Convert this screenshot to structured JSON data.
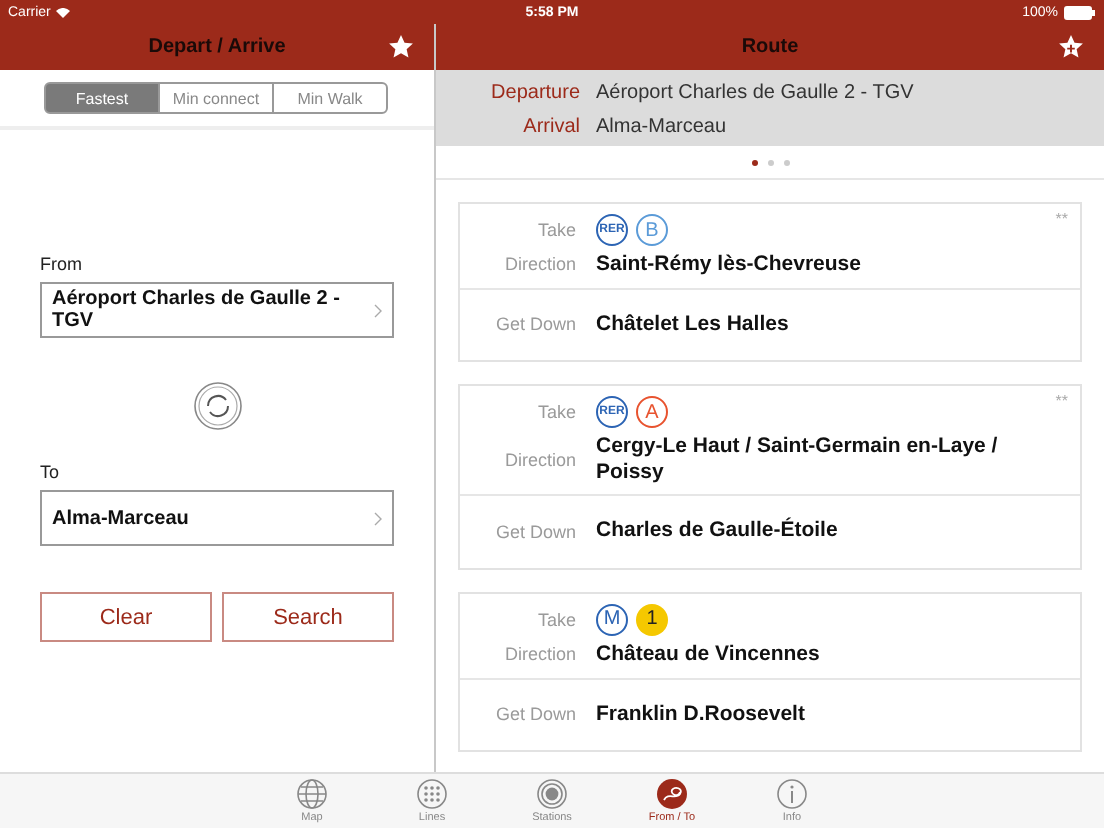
{
  "status_bar": {
    "carrier": "Carrier",
    "time": "5:58 PM",
    "battery": "100%"
  },
  "left_panel": {
    "title": "Depart / Arrive",
    "segments": [
      {
        "label": "Fastest",
        "selected": true
      },
      {
        "label": "Min connect",
        "selected": false
      },
      {
        "label": "Min Walk",
        "selected": false
      }
    ],
    "from": {
      "label": "From",
      "value": "Aéroport Charles de Gaulle 2 - TGV"
    },
    "to": {
      "label": "To",
      "value": "Alma-Marceau"
    },
    "buttons": [
      "Clear",
      "Search"
    ]
  },
  "right_panel": {
    "title": "Route",
    "summary": [
      {
        "label": "Departure",
        "value": "Aéroport Charles de Gaulle 2 - TGV"
      },
      {
        "label": "Arrival",
        "value": "Alma-Marceau"
      }
    ],
    "pages": [
      {
        "selected": true
      },
      {
        "selected": false
      },
      {
        "selected": false
      }
    ],
    "legs": [
      {
        "take_label": "Take",
        "badges": [
          {
            "label": "RER",
            "kind": "outline",
            "color": "#2c64b4"
          },
          {
            "label": "B",
            "kind": "outline",
            "color": "#5b9bd8"
          }
        ],
        "direction_label": "Direction",
        "direction": "Saint-Rémy lès-Chevreuse",
        "get_down_label": "Get Down",
        "get_down": "Châtelet Les Halles",
        "mark": "**"
      },
      {
        "take_label": "Take",
        "badges": [
          {
            "label": "RER",
            "kind": "outline",
            "color": "#2c64b4"
          },
          {
            "label": "A",
            "kind": "outline",
            "color": "#e8532f"
          }
        ],
        "direction_label": "Direction",
        "direction": "Cergy-Le Haut / Saint-Germain en-Laye / Poissy",
        "get_down_label": "Get Down",
        "get_down": "Charles de Gaulle-Étoile",
        "mark": "**"
      },
      {
        "take_label": "Take",
        "badges": [
          {
            "label": "M",
            "kind": "outline",
            "color": "#2c64b4"
          },
          {
            "label": "1",
            "kind": "filled",
            "color": "#f5c800"
          }
        ],
        "direction_label": "Direction",
        "direction": "Château de Vincennes",
        "get_down_label": "Get Down",
        "get_down": "Franklin D.Roosevelt"
      }
    ]
  },
  "tab_bar": [
    {
      "label": "Map",
      "selected": false
    },
    {
      "label": "Lines",
      "selected": false
    },
    {
      "label": "Stations",
      "selected": false
    },
    {
      "label": "From / To",
      "selected": true
    },
    {
      "label": "Info",
      "selected": false
    }
  ]
}
